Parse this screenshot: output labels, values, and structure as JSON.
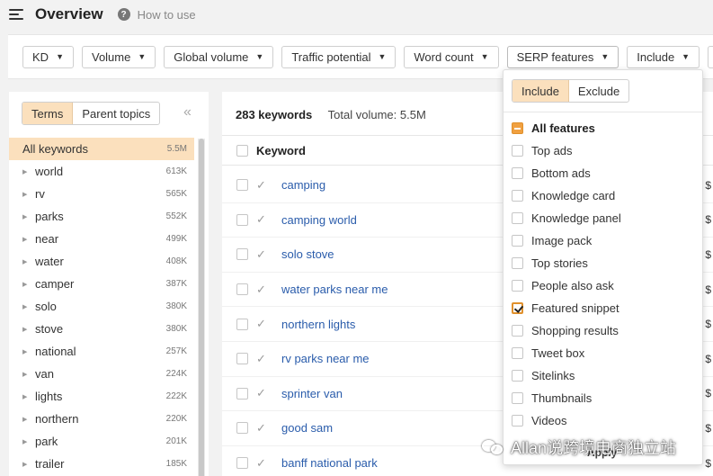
{
  "header": {
    "title": "Overview",
    "help_label": "How to use"
  },
  "filters": [
    "KD",
    "Volume",
    "Global volume",
    "Traffic potential",
    "Word count",
    "SERP features",
    "Include"
  ],
  "left_panel": {
    "tabs": [
      "Terms",
      "Parent topics"
    ],
    "collapse_glyph": "«",
    "all_keywords": {
      "name": "All keywords",
      "count": "5.5M"
    },
    "terms": [
      {
        "name": "world",
        "count": "613K"
      },
      {
        "name": "rv",
        "count": "565K"
      },
      {
        "name": "parks",
        "count": "552K"
      },
      {
        "name": "near",
        "count": "499K"
      },
      {
        "name": "water",
        "count": "408K"
      },
      {
        "name": "camper",
        "count": "387K"
      },
      {
        "name": "solo",
        "count": "380K"
      },
      {
        "name": "stove",
        "count": "380K"
      },
      {
        "name": "national",
        "count": "257K"
      },
      {
        "name": "van",
        "count": "224K"
      },
      {
        "name": "lights",
        "count": "222K"
      },
      {
        "name": "northern",
        "count": "220K"
      },
      {
        "name": "park",
        "count": "201K"
      },
      {
        "name": "trailer",
        "count": "185K"
      }
    ]
  },
  "main": {
    "keyword_count": "283 keywords",
    "total_volume": "Total volume: 5.5M",
    "column_keyword": "Keyword",
    "keywords": [
      "camping",
      "camping world",
      "solo stove",
      "water parks near me",
      "northern lights",
      "rv parks near me",
      "sprinter van",
      "good sam",
      "banff national park"
    ],
    "edge_glyph": "$"
  },
  "serp_dropdown": {
    "modes": [
      "Include",
      "Exclude"
    ],
    "options": [
      {
        "label": "All features",
        "state": "partial"
      },
      {
        "label": "Top ads",
        "state": "off"
      },
      {
        "label": "Bottom ads",
        "state": "off"
      },
      {
        "label": "Knowledge card",
        "state": "off"
      },
      {
        "label": "Knowledge panel",
        "state": "off"
      },
      {
        "label": "Image pack",
        "state": "off"
      },
      {
        "label": "Top stories",
        "state": "off"
      },
      {
        "label": "People also ask",
        "state": "off"
      },
      {
        "label": "Featured snippet",
        "state": "checked"
      },
      {
        "label": "Shopping results",
        "state": "off"
      },
      {
        "label": "Tweet box",
        "state": "off"
      },
      {
        "label": "Sitelinks",
        "state": "off"
      },
      {
        "label": "Thumbnails",
        "state": "off"
      },
      {
        "label": "Videos",
        "state": "off"
      }
    ],
    "apply_label": "Apply"
  },
  "watermark": {
    "text": "Allan说跨境电商独立站"
  },
  "icons": {
    "menu": "hamburger-icon",
    "help": "question-circle-icon",
    "caret": "caret-down-icon",
    "check": "checkmark-icon",
    "expand": "triangle-right-icon"
  }
}
